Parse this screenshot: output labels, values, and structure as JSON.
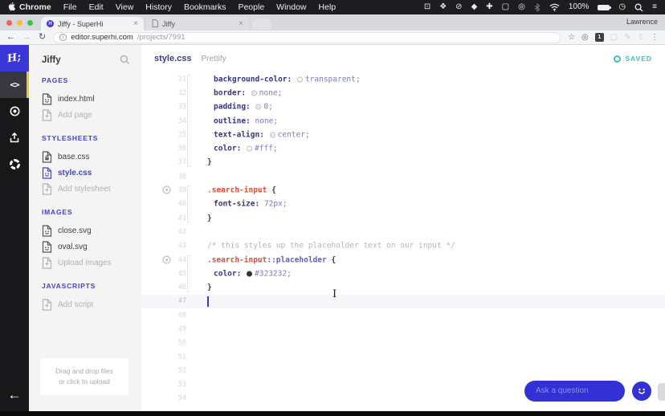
{
  "colors": {
    "accent_blue": "#3b36d8",
    "active_item_blue": "#4340d6",
    "saved_teal": "#3fbfae",
    "selector_red": "#e14b39",
    "rail_accent_yellow": "#e9c338"
  },
  "menu_bar": {
    "app_name": "Chrome",
    "items": [
      "File",
      "Edit",
      "View",
      "History",
      "Bookmarks",
      "People",
      "Window",
      "Help"
    ],
    "status_icons": [
      {
        "name": "display-icon",
        "glyph": "⊡"
      },
      {
        "name": "dropbox-icon",
        "glyph": "❖"
      },
      {
        "name": "do-not-disturb-icon",
        "glyph": "⊘"
      },
      {
        "name": "droplet-icon",
        "glyph": "◆"
      },
      {
        "name": "health-icon",
        "glyph": "✚"
      },
      {
        "name": "window-icon",
        "glyph": "▢"
      },
      {
        "name": "record-icon",
        "glyph": "◎"
      },
      {
        "name": "bluetooth-icon",
        "glyph": "svg",
        "dim": true
      },
      {
        "name": "wifi-icon",
        "glyph": "svg"
      },
      {
        "name": "battery-percent-label",
        "glyph": "100%"
      },
      {
        "name": "battery-icon",
        "glyph": "battery"
      },
      {
        "name": "clock-icon",
        "glyph": "◷"
      },
      {
        "name": "spotlight-icon",
        "glyph": "svg"
      },
      {
        "name": "notification-center-icon",
        "glyph": "≡"
      }
    ]
  },
  "browser": {
    "tab1_title": "Jiffy - SuperHi",
    "tab2_title": "Jiffy",
    "close_glyph": "×",
    "profile": "Lawrence",
    "url_host": "editor.superhi.com",
    "url_path": "/projects/7991",
    "ext_icons": [
      {
        "name": "bookmark-star-icon",
        "glyph": "☆"
      },
      {
        "name": "extension-badge-icon",
        "glyph": "◎"
      },
      {
        "name": "password-manager-icon",
        "glyph": "1",
        "boxed": true
      },
      {
        "name": "extension-disabled-icon-1",
        "glyph": "▢",
        "dim": true
      },
      {
        "name": "extension-disabled-icon-2",
        "glyph": "✎",
        "dim": true
      },
      {
        "name": "extension-disabled-icon-3",
        "glyph": "⇧",
        "dim": true
      },
      {
        "name": "menu-dots-icon",
        "glyph": "⋮"
      }
    ]
  },
  "sidebar": {
    "project_title": "Jiffy",
    "sections": [
      {
        "label": "PAGES",
        "items": [
          {
            "label": "index.html",
            "icon": "file"
          },
          {
            "label": "Add page",
            "icon": "add"
          }
        ]
      },
      {
        "label": "STYLESHEETS",
        "items": [
          {
            "label": "base.css",
            "icon": "locked"
          },
          {
            "label": "style.css",
            "icon": "file",
            "active": true
          },
          {
            "label": "Add stylesheet",
            "icon": "add"
          }
        ]
      },
      {
        "label": "IMAGES",
        "items": [
          {
            "label": "close.svg",
            "icon": "file"
          },
          {
            "label": "oval.svg",
            "icon": "file"
          },
          {
            "label": "Upload images",
            "icon": "add"
          }
        ]
      },
      {
        "label": "JAVASCRIPTS",
        "items": [
          {
            "label": "Add script",
            "icon": "add"
          }
        ]
      }
    ],
    "dropzone_line1": "Drag and drop files",
    "dropzone_line2": "or click to upload"
  },
  "editor": {
    "file_tab": "style.css",
    "prettify_label": "Prettify",
    "saved_label": "SAVED",
    "first_line": 31,
    "cursor_line": 47,
    "last_line": 54,
    "scopes": [
      {
        "from": 31,
        "to": 37
      },
      {
        "from": 39,
        "to": 41
      },
      {
        "from": 44,
        "to": 46
      }
    ],
    "lines": [
      {
        "n": 31,
        "ind": 1,
        "tok": [
          [
            "p",
            "background-color: "
          ],
          [
            "sw",
            "ring"
          ],
          [
            "v",
            "transparent;"
          ]
        ]
      },
      {
        "n": 32,
        "ind": 1,
        "tok": [
          [
            "p",
            "border: "
          ],
          [
            "sw",
            "none"
          ],
          [
            "v",
            "none;"
          ]
        ]
      },
      {
        "n": 33,
        "ind": 1,
        "tok": [
          [
            "p",
            "padding: "
          ],
          [
            "sw",
            "none"
          ],
          [
            "v",
            "0;"
          ]
        ]
      },
      {
        "n": 34,
        "ind": 1,
        "tok": [
          [
            "p",
            "outline: "
          ],
          [
            "v",
            "none;"
          ]
        ]
      },
      {
        "n": 35,
        "ind": 1,
        "tok": [
          [
            "p",
            "text-align: "
          ],
          [
            "sw",
            "none"
          ],
          [
            "v",
            "center;"
          ]
        ]
      },
      {
        "n": 36,
        "ind": 1,
        "tok": [
          [
            "p",
            "color: "
          ],
          [
            "sw",
            "white"
          ],
          [
            "v",
            "#fff;"
          ]
        ]
      },
      {
        "n": 37,
        "ind": 0,
        "tok": [
          [
            "b",
            "}"
          ]
        ]
      },
      {
        "n": 38,
        "ind": 0,
        "tok": []
      },
      {
        "n": 39,
        "ind": 0,
        "eye": true,
        "tok": [
          [
            "s",
            ".search-input "
          ],
          [
            "b",
            "{"
          ]
        ]
      },
      {
        "n": 40,
        "ind": 1,
        "tok": [
          [
            "p",
            "font-size: "
          ],
          [
            "v",
            "72px;"
          ]
        ]
      },
      {
        "n": 41,
        "ind": 0,
        "tok": [
          [
            "b",
            "}"
          ]
        ]
      },
      {
        "n": 42,
        "ind": 0,
        "tok": []
      },
      {
        "n": 43,
        "ind": 0,
        "tok": [
          [
            "m",
            "/* this styles up the placeholder text on our input */"
          ]
        ]
      },
      {
        "n": 44,
        "ind": 0,
        "eye": true,
        "tok": [
          [
            "s",
            ".search-input"
          ],
          [
            "ps",
            "::placeholder "
          ],
          [
            "b",
            "{"
          ]
        ]
      },
      {
        "n": 45,
        "ind": 1,
        "tok": [
          [
            "p",
            "color: "
          ],
          [
            "sw",
            "dark"
          ],
          [
            "v",
            "#323232;"
          ]
        ]
      },
      {
        "n": 46,
        "ind": 0,
        "tok": [
          [
            "b",
            "}"
          ]
        ]
      },
      {
        "n": 47,
        "ind": 0,
        "cursor": true,
        "tok": []
      }
    ]
  },
  "chat": {
    "placeholder": "Ask a question"
  }
}
